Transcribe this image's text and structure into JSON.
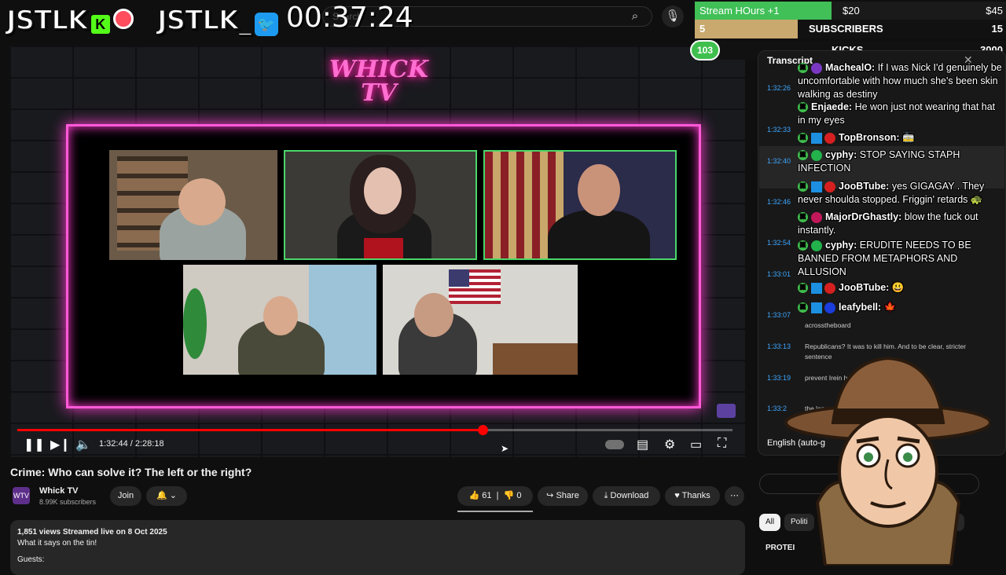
{
  "overlay": {
    "logo1": "JSTLK",
    "logo1_badge": "K",
    "logo2": "JSTLK_",
    "logo2_badge": "🐦",
    "timer": "00:37:24",
    "goal_row1": {
      "label": "Stream HOurs +1",
      "mid": "$20",
      "right": "$45",
      "fill": 0.44
    },
    "goal_row2": {
      "left": "5",
      "label": "SUBSCRIBERS",
      "right": "15",
      "fill": 0.33
    },
    "goal_row3": {
      "left": "103",
      "label": "KICKS",
      "right": "3000",
      "fill": 0.03
    },
    "accent_green": "#40c057",
    "accent_tan": "#c9a96e"
  },
  "search": {
    "placeholder": "Search"
  },
  "video": {
    "logo_text": "WHICK TV",
    "timecode": "1:32:44 / 2:28:18",
    "progress": 0.6509,
    "title": "Crime: Who can solve it? The left or the right?"
  },
  "channel": {
    "avatar_text": "WTV",
    "name": "Whick TV",
    "subscribers": "8.99K subscribers",
    "join_label": "Join",
    "bell": "🔔"
  },
  "actions": {
    "likes": "61",
    "dislikes": "0",
    "share": "Share",
    "download": "Download",
    "thanks": "Thanks",
    "more": "⋯"
  },
  "description": {
    "stats": "1,851 views  Streamed live on 8 Oct 2025",
    "text": "What it says on the tin!",
    "extra": "Guests:"
  },
  "transcript": {
    "title": "Transcript",
    "language": "English (auto-g",
    "timestamps": [
      "1:32:26",
      "1:32:33",
      "1:32:40",
      "1:32:46",
      "1:32:54",
      "1:33:01",
      "1:33:07",
      "1:33:13",
      "1:33:19",
      "1:33:2"
    ],
    "segments": [
      "acrosstheboard",
      "Republicans? It was to kill him. And to be clear, stricter sentence",
      "prevent Irein                                  he's in jail, no, n",
      "the len"
    ],
    "chips": [
      "All",
      "Politi",
      "ed"
    ],
    "section": "PROTEI"
  },
  "chat": [
    {
      "user": "MachealO:",
      "msg": " If I was Nick I'd genuinely be uncomfortable with how much she's been skin walking as destiny",
      "dot": "#7a38c2"
    },
    {
      "user": "Enjaede:",
      "msg": " He won just not wearing that hat in my eyes",
      "dot": ""
    },
    {
      "user": "TopBronson:",
      "msg": " 🚋",
      "dot": "#d62020"
    },
    {
      "user": "cyphy:",
      "msg": " STOP SAYING STAPH INFECTION",
      "dot": "#23b24b"
    },
    {
      "user": "JooBTube:",
      "msg": " yes GIGAGAY . They never shoulda stopped. Friggin' retards 🐢",
      "dot": "#d62020"
    },
    {
      "user": "MajorDrGhastly:",
      "msg": " blow the fuck out instantly.",
      "dot": "#c2185b"
    },
    {
      "user": "cyphy:",
      "msg": " ERUDITE NEEDS TO BE BANNED FROM METAPHORS AND ALLUSION",
      "dot": "#23b24b"
    },
    {
      "user": "JooBTube:",
      "msg": " 😃",
      "dot": "#d62020"
    },
    {
      "user": "leafybell:",
      "msg": " 🍁",
      "dot": "#1a3ddb"
    }
  ]
}
